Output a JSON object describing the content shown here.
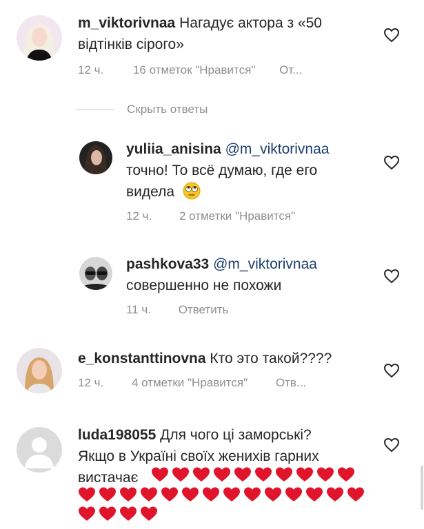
{
  "comments": [
    {
      "username": "m_viktorivnaa",
      "text_line1": "Нагадує актора з «50",
      "text_line2": "відтінків сірого»",
      "time": "12 ч.",
      "likes": "16 отметок \"Нравится\"",
      "reply": "От..."
    },
    {
      "username": "yuliia_anisina",
      "mention": "@m_viktorivnaa",
      "text_line1": "точно! То всё думаю,  где его",
      "text_line2": "видела",
      "emoji": "face-with-rolling-eyes",
      "time": "12 ч.",
      "likes": "2 отметки \"Нравится\""
    },
    {
      "username": "pashkova33",
      "mention": "@m_viktorivnaa",
      "text_line1": "совершенно не похожи",
      "time": "11 ч.",
      "reply": "Ответить"
    },
    {
      "username": "e_konstanttinovna",
      "text_line1": "Кто это такой????",
      "time": "12 ч.",
      "likes": "4 отметки \"Нравится\"",
      "reply": "Отв..."
    },
    {
      "username": "luda198055",
      "text_line1": "Для чого ці заморські?",
      "text_line2": "Якщо в Україні своїх женихів гарних",
      "text_line3": "вистачає",
      "heart_emoji_count": 28
    }
  ],
  "hide_replies_label": "Скрыть ответы",
  "icons": {
    "like": "heart-outline-icon",
    "emoji_heart": "red-heart-emoji"
  },
  "colors": {
    "text": "#262626",
    "secondary": "#8e8e8e",
    "mention": "#1c3f6e",
    "heart_emoji": "#e0142b"
  }
}
